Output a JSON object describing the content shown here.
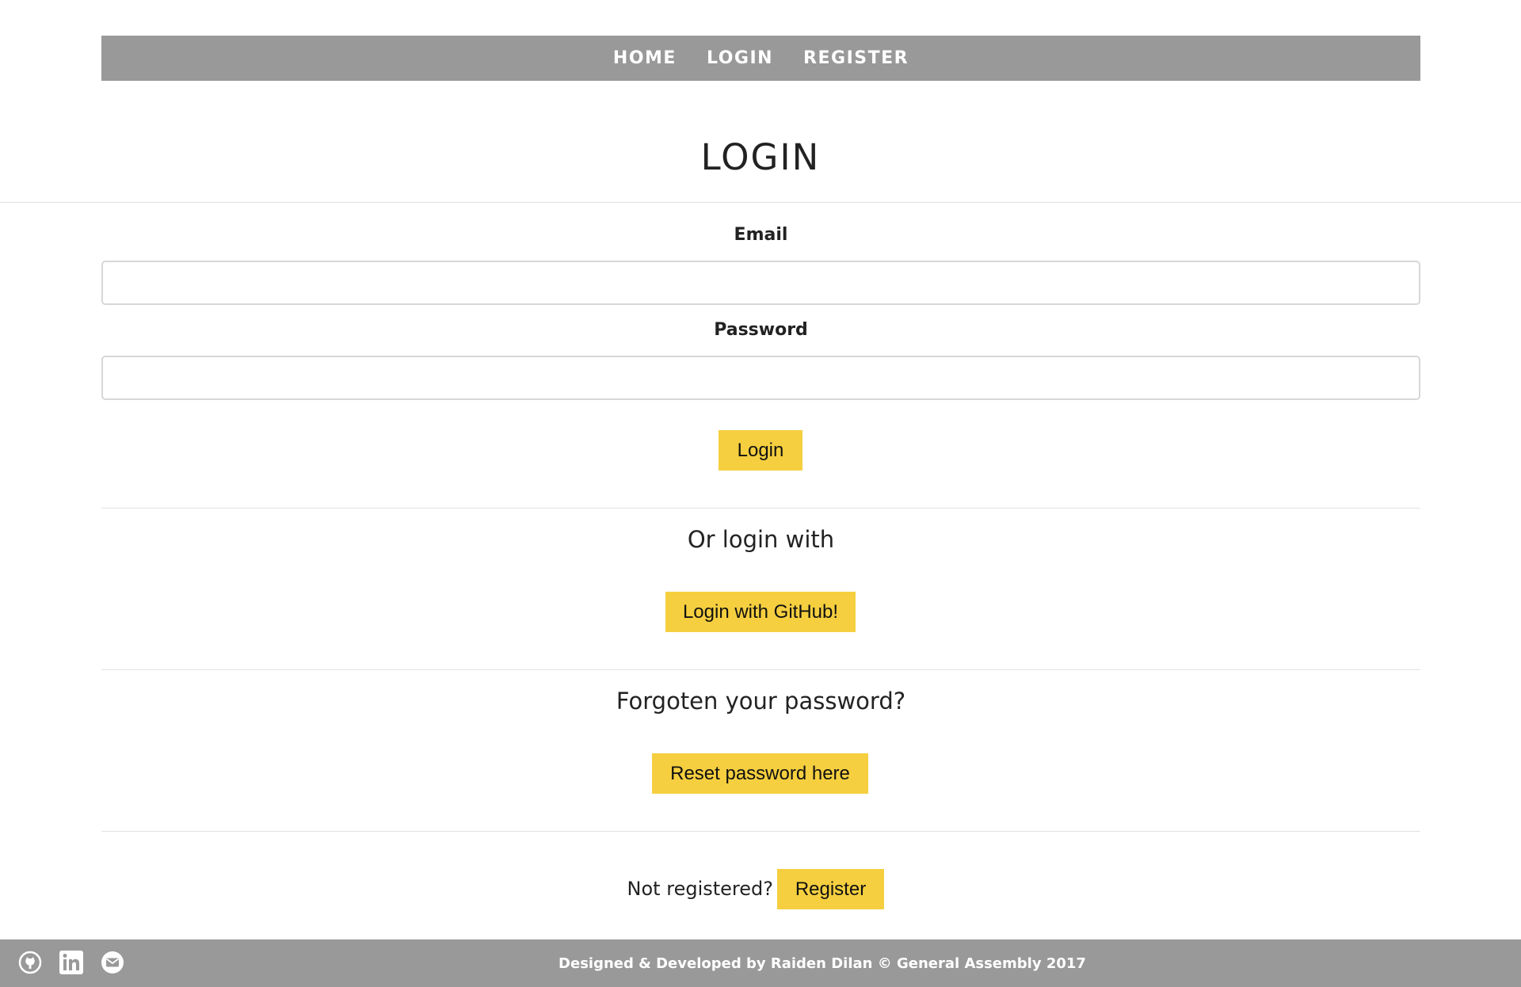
{
  "nav": {
    "items": [
      {
        "label": "HOME"
      },
      {
        "label": "LOGIN"
      },
      {
        "label": "REGISTER"
      }
    ]
  },
  "page": {
    "title": "LOGIN"
  },
  "form": {
    "email_label": "Email",
    "email_value": "",
    "password_label": "Password",
    "password_value": "",
    "login_button": "Login"
  },
  "alt_login": {
    "heading": "Or login with",
    "github_button": "Login with GitHub!"
  },
  "forgot": {
    "heading": "Forgoten your password?",
    "reset_button": "Reset password here"
  },
  "register": {
    "prompt": "Not registered?",
    "button": "Register"
  },
  "footer": {
    "credit": "Designed & Developed by Raiden Dilan © General Assembly 2017",
    "icons": [
      "github-icon",
      "linkedin-icon",
      "email-icon"
    ]
  },
  "colors": {
    "nav_bg": "#999999",
    "button_yellow": "#f5cf3f",
    "footer_bg": "#999999",
    "text_dark": "#222222"
  }
}
